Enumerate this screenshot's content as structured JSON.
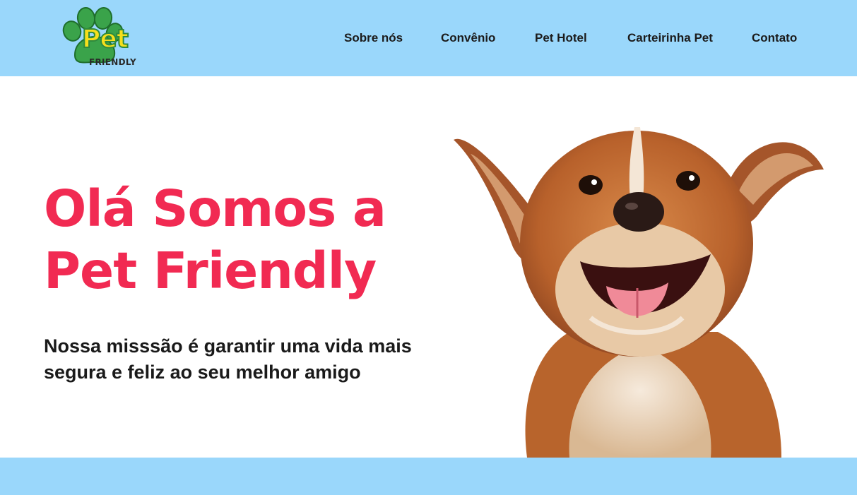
{
  "header": {
    "logo": {
      "word": "Pet",
      "subword": "FRIENDLY",
      "icon": "paw-print-icon"
    },
    "nav": [
      {
        "label": "Sobre nós"
      },
      {
        "label": "Convênio"
      },
      {
        "label": "Pet Hotel"
      },
      {
        "label": "Carteirinha Pet"
      },
      {
        "label": "Contato"
      }
    ]
  },
  "hero": {
    "title_line1": "Olá Somos a",
    "title_line2": "Pet Friendly",
    "subtitle": "Nossa misssão é garantir uma vida mais segura e feliz ao seu melhor amigo",
    "image": "happy-dog-photo"
  },
  "colors": {
    "header_bg": "#9ad7fb",
    "title": "#f12a52",
    "logo_green": "#2e8a3d",
    "logo_yellow": "#f6df1c"
  }
}
